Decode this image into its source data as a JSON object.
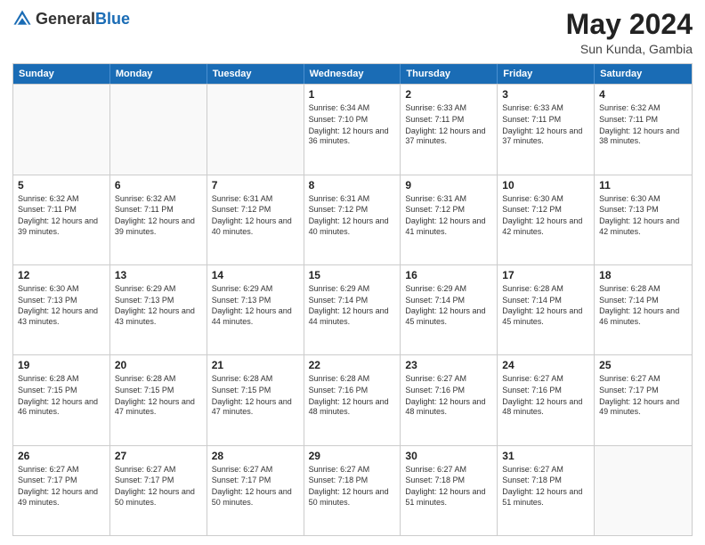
{
  "header": {
    "logo_general": "General",
    "logo_blue": "Blue",
    "month_year": "May 2024",
    "location": "Sun Kunda, Gambia"
  },
  "days_of_week": [
    "Sunday",
    "Monday",
    "Tuesday",
    "Wednesday",
    "Thursday",
    "Friday",
    "Saturday"
  ],
  "weeks": [
    [
      {
        "day": "",
        "sunrise": "",
        "sunset": "",
        "daylight": "",
        "empty": true
      },
      {
        "day": "",
        "sunrise": "",
        "sunset": "",
        "daylight": "",
        "empty": true
      },
      {
        "day": "",
        "sunrise": "",
        "sunset": "",
        "daylight": "",
        "empty": true
      },
      {
        "day": "1",
        "sunrise": "Sunrise: 6:34 AM",
        "sunset": "Sunset: 7:10 PM",
        "daylight": "Daylight: 12 hours and 36 minutes.",
        "empty": false
      },
      {
        "day": "2",
        "sunrise": "Sunrise: 6:33 AM",
        "sunset": "Sunset: 7:11 PM",
        "daylight": "Daylight: 12 hours and 37 minutes.",
        "empty": false
      },
      {
        "day": "3",
        "sunrise": "Sunrise: 6:33 AM",
        "sunset": "Sunset: 7:11 PM",
        "daylight": "Daylight: 12 hours and 37 minutes.",
        "empty": false
      },
      {
        "day": "4",
        "sunrise": "Sunrise: 6:32 AM",
        "sunset": "Sunset: 7:11 PM",
        "daylight": "Daylight: 12 hours and 38 minutes.",
        "empty": false
      }
    ],
    [
      {
        "day": "5",
        "sunrise": "Sunrise: 6:32 AM",
        "sunset": "Sunset: 7:11 PM",
        "daylight": "Daylight: 12 hours and 39 minutes.",
        "empty": false
      },
      {
        "day": "6",
        "sunrise": "Sunrise: 6:32 AM",
        "sunset": "Sunset: 7:11 PM",
        "daylight": "Daylight: 12 hours and 39 minutes.",
        "empty": false
      },
      {
        "day": "7",
        "sunrise": "Sunrise: 6:31 AM",
        "sunset": "Sunset: 7:12 PM",
        "daylight": "Daylight: 12 hours and 40 minutes.",
        "empty": false
      },
      {
        "day": "8",
        "sunrise": "Sunrise: 6:31 AM",
        "sunset": "Sunset: 7:12 PM",
        "daylight": "Daylight: 12 hours and 40 minutes.",
        "empty": false
      },
      {
        "day": "9",
        "sunrise": "Sunrise: 6:31 AM",
        "sunset": "Sunset: 7:12 PM",
        "daylight": "Daylight: 12 hours and 41 minutes.",
        "empty": false
      },
      {
        "day": "10",
        "sunrise": "Sunrise: 6:30 AM",
        "sunset": "Sunset: 7:12 PM",
        "daylight": "Daylight: 12 hours and 42 minutes.",
        "empty": false
      },
      {
        "day": "11",
        "sunrise": "Sunrise: 6:30 AM",
        "sunset": "Sunset: 7:13 PM",
        "daylight": "Daylight: 12 hours and 42 minutes.",
        "empty": false
      }
    ],
    [
      {
        "day": "12",
        "sunrise": "Sunrise: 6:30 AM",
        "sunset": "Sunset: 7:13 PM",
        "daylight": "Daylight: 12 hours and 43 minutes.",
        "empty": false
      },
      {
        "day": "13",
        "sunrise": "Sunrise: 6:29 AM",
        "sunset": "Sunset: 7:13 PM",
        "daylight": "Daylight: 12 hours and 43 minutes.",
        "empty": false
      },
      {
        "day": "14",
        "sunrise": "Sunrise: 6:29 AM",
        "sunset": "Sunset: 7:13 PM",
        "daylight": "Daylight: 12 hours and 44 minutes.",
        "empty": false
      },
      {
        "day": "15",
        "sunrise": "Sunrise: 6:29 AM",
        "sunset": "Sunset: 7:14 PM",
        "daylight": "Daylight: 12 hours and 44 minutes.",
        "empty": false
      },
      {
        "day": "16",
        "sunrise": "Sunrise: 6:29 AM",
        "sunset": "Sunset: 7:14 PM",
        "daylight": "Daylight: 12 hours and 45 minutes.",
        "empty": false
      },
      {
        "day": "17",
        "sunrise": "Sunrise: 6:28 AM",
        "sunset": "Sunset: 7:14 PM",
        "daylight": "Daylight: 12 hours and 45 minutes.",
        "empty": false
      },
      {
        "day": "18",
        "sunrise": "Sunrise: 6:28 AM",
        "sunset": "Sunset: 7:14 PM",
        "daylight": "Daylight: 12 hours and 46 minutes.",
        "empty": false
      }
    ],
    [
      {
        "day": "19",
        "sunrise": "Sunrise: 6:28 AM",
        "sunset": "Sunset: 7:15 PM",
        "daylight": "Daylight: 12 hours and 46 minutes.",
        "empty": false
      },
      {
        "day": "20",
        "sunrise": "Sunrise: 6:28 AM",
        "sunset": "Sunset: 7:15 PM",
        "daylight": "Daylight: 12 hours and 47 minutes.",
        "empty": false
      },
      {
        "day": "21",
        "sunrise": "Sunrise: 6:28 AM",
        "sunset": "Sunset: 7:15 PM",
        "daylight": "Daylight: 12 hours and 47 minutes.",
        "empty": false
      },
      {
        "day": "22",
        "sunrise": "Sunrise: 6:28 AM",
        "sunset": "Sunset: 7:16 PM",
        "daylight": "Daylight: 12 hours and 48 minutes.",
        "empty": false
      },
      {
        "day": "23",
        "sunrise": "Sunrise: 6:27 AM",
        "sunset": "Sunset: 7:16 PM",
        "daylight": "Daylight: 12 hours and 48 minutes.",
        "empty": false
      },
      {
        "day": "24",
        "sunrise": "Sunrise: 6:27 AM",
        "sunset": "Sunset: 7:16 PM",
        "daylight": "Daylight: 12 hours and 48 minutes.",
        "empty": false
      },
      {
        "day": "25",
        "sunrise": "Sunrise: 6:27 AM",
        "sunset": "Sunset: 7:17 PM",
        "daylight": "Daylight: 12 hours and 49 minutes.",
        "empty": false
      }
    ],
    [
      {
        "day": "26",
        "sunrise": "Sunrise: 6:27 AM",
        "sunset": "Sunset: 7:17 PM",
        "daylight": "Daylight: 12 hours and 49 minutes.",
        "empty": false
      },
      {
        "day": "27",
        "sunrise": "Sunrise: 6:27 AM",
        "sunset": "Sunset: 7:17 PM",
        "daylight": "Daylight: 12 hours and 50 minutes.",
        "empty": false
      },
      {
        "day": "28",
        "sunrise": "Sunrise: 6:27 AM",
        "sunset": "Sunset: 7:17 PM",
        "daylight": "Daylight: 12 hours and 50 minutes.",
        "empty": false
      },
      {
        "day": "29",
        "sunrise": "Sunrise: 6:27 AM",
        "sunset": "Sunset: 7:18 PM",
        "daylight": "Daylight: 12 hours and 50 minutes.",
        "empty": false
      },
      {
        "day": "30",
        "sunrise": "Sunrise: 6:27 AM",
        "sunset": "Sunset: 7:18 PM",
        "daylight": "Daylight: 12 hours and 51 minutes.",
        "empty": false
      },
      {
        "day": "31",
        "sunrise": "Sunrise: 6:27 AM",
        "sunset": "Sunset: 7:18 PM",
        "daylight": "Daylight: 12 hours and 51 minutes.",
        "empty": false
      },
      {
        "day": "",
        "sunrise": "",
        "sunset": "",
        "daylight": "",
        "empty": true
      }
    ]
  ]
}
